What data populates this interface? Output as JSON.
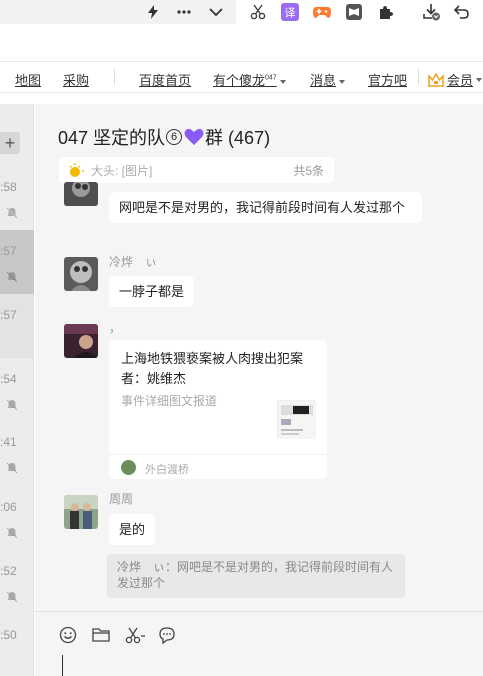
{
  "nav": {
    "map": "地图",
    "shop": "采购",
    "baidu": "百度首页",
    "user": "有个傻龙",
    "user_sup": "047",
    "messages": "消息",
    "official": "官方吧",
    "vip": "会员"
  },
  "sessions": {
    "times": [
      ":58",
      ":57",
      ":57",
      ":54",
      ":41",
      ":06",
      ":52",
      ":50"
    ]
  },
  "chat": {
    "title_prefix": "047 坚定的队",
    "title_circled": "⑥",
    "title_suffix": "群 (467)",
    "heart_color": "#8a5cf6",
    "pinned": {
      "text": "大头: [图片]",
      "count": "共5条"
    },
    "messages": [
      {
        "sender": "",
        "text": "网吧是不是对男的，我记得前段时间有人发过那个"
      },
      {
        "sender": "冷烨　ぃ",
        "text": "一脖子都是"
      },
      {
        "sender": "，",
        "card": {
          "title": "上海地铁猥亵案被人肉搜出犯案者：姚维杰",
          "desc": "事件详细图文报道",
          "source": "外白渡桥"
        }
      },
      {
        "sender": "周周",
        "text": "是的"
      }
    ],
    "quote": "冷烨　ぃ：网吧是不是对男的，我记得前段时间有人发过那个"
  }
}
